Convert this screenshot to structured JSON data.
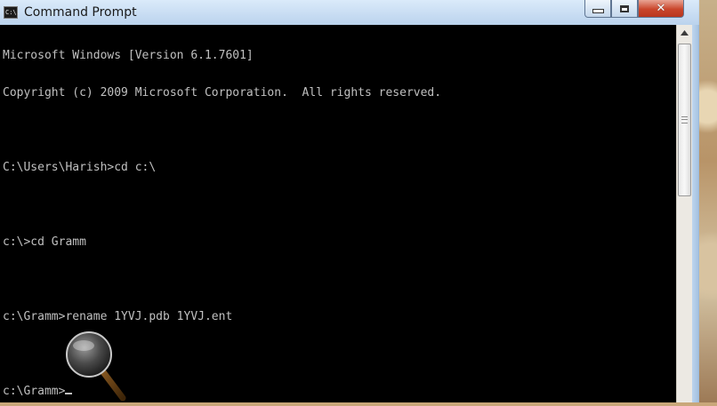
{
  "window": {
    "title": "Command Prompt",
    "icon_label": "C:\\."
  },
  "controls": {
    "minimize": "minimize-icon",
    "maximize": "maximize-icon",
    "close_glyph": "✕"
  },
  "console": {
    "lines": [
      "Microsoft Windows [Version 6.1.7601]",
      "Copyright (c) 2009 Microsoft Corporation.  All rights reserved.",
      "",
      "C:\\Users\\Harish>cd c:\\",
      "",
      "c:\\>cd Gramm",
      "",
      "c:\\Gramm>rename 1YVJ.pdb 1YVJ.ent",
      "",
      "c:\\Gramm>"
    ]
  },
  "icons": {
    "magnifier": "magnifier-icon",
    "scroll_up": "scroll-up-arrow-icon"
  },
  "colors": {
    "console_bg": "#000000",
    "console_text": "#c0c0c0",
    "close_button": "#c9452b"
  }
}
